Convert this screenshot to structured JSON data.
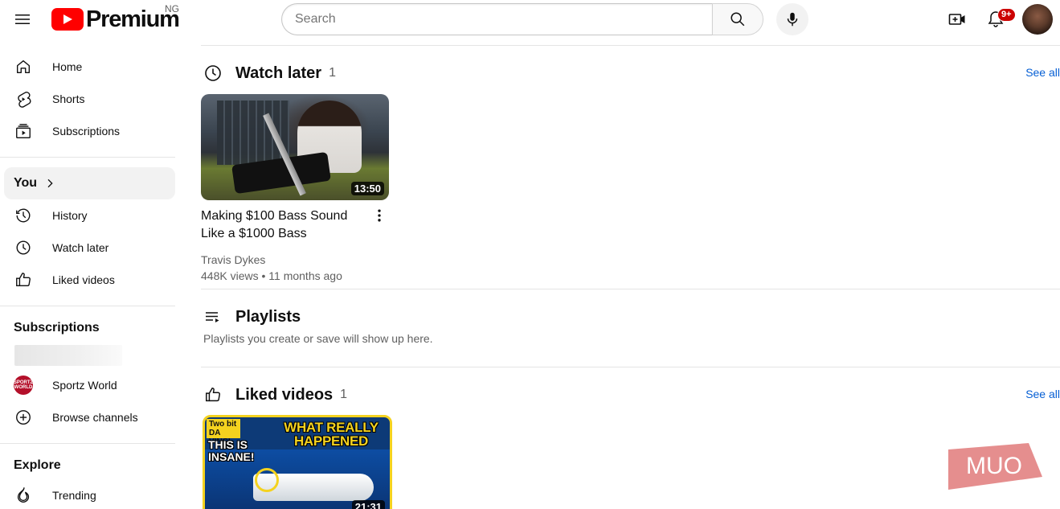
{
  "header": {
    "logo_text": "Premium",
    "country": "NG",
    "search_placeholder": "Search",
    "notification_count": "9+"
  },
  "sidebar": {
    "main_items": [
      {
        "label": "Home",
        "icon": "home-icon"
      },
      {
        "label": "Shorts",
        "icon": "shorts-icon"
      },
      {
        "label": "Subscriptions",
        "icon": "subscriptions-icon"
      }
    ],
    "you_label": "You",
    "you_items": [
      {
        "label": "History",
        "icon": "history-icon"
      },
      {
        "label": "Watch later",
        "icon": "watch-later-icon"
      },
      {
        "label": "Liked videos",
        "icon": "thumbs-up-icon"
      }
    ],
    "subscriptions_title": "Subscriptions",
    "subscription_items": [
      {
        "label": "Sportz World",
        "icon": "channel-avatar"
      },
      {
        "label": "Browse channels",
        "icon": "plus-circle-icon"
      }
    ],
    "sportz_avatar_text": "SPORTZ WORLD",
    "explore_title": "Explore",
    "explore_items": [
      {
        "label": "Trending",
        "icon": "trending-icon"
      }
    ]
  },
  "main": {
    "watch_later": {
      "title": "Watch later",
      "count": "1",
      "see_all": "See all",
      "video": {
        "title": "Making $100 Bass Sound Like a $1000 Bass",
        "channel": "Travis Dykes",
        "meta": "448K views • 11 months ago",
        "duration": "13:50"
      }
    },
    "playlists": {
      "title": "Playlists",
      "description": "Playlists you create or save will show up here."
    },
    "liked_videos": {
      "title": "Liked videos",
      "count": "1",
      "see_all": "See all",
      "video": {
        "badge": "Two bit DA VINCI",
        "headline": "WHAT REALLY HAPPENED",
        "subheadline": "THIS IS INSANE!",
        "duration": "21:31"
      }
    }
  },
  "watermark": "MUO",
  "colors": {
    "brand_red": "#ff0000",
    "link_blue": "#065fd4",
    "badge_red": "#cc0000"
  }
}
